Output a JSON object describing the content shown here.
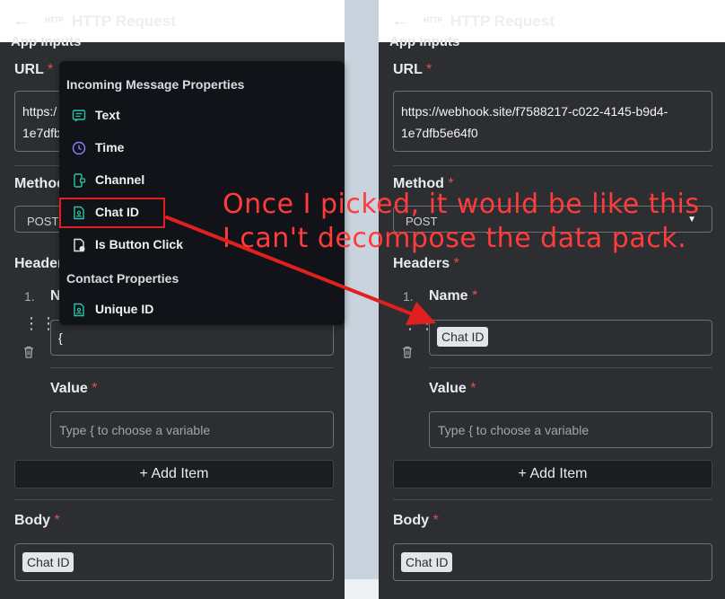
{
  "header": {
    "badge": "HTTP",
    "title": "HTTP Request",
    "back_icon": "arrow-left-icon"
  },
  "section_label": "App Inputs",
  "labels": {
    "url": "URL",
    "method": "Method",
    "headers": "Headers",
    "name": "Name",
    "value": "Value",
    "body": "Body",
    "required_mark": "*"
  },
  "left": {
    "url_line1": "https:/",
    "url_line2": "1e7dfb",
    "method_value": "POST",
    "name_value": "{",
    "value_placeholder": "Type { to choose a variable",
    "add_item": "+ Add Item",
    "body_chip": "Chat ID",
    "list_number": "1."
  },
  "right": {
    "url_line1": "https://webhook.site/f7588217-c022-4145-b9d4-",
    "url_line2": "1e7dfb5e64f0",
    "method_value": "POST",
    "name_chip": "Chat ID",
    "value_placeholder": "Type { to choose a variable",
    "add_item": "+ Add Item",
    "body_chip": "Chat ID",
    "list_number": "1."
  },
  "dropdown": {
    "heading_incoming": "Incoming Message Properties",
    "items_incoming": [
      {
        "label": "Text",
        "icon": "message-icon"
      },
      {
        "label": "Time",
        "icon": "clock-icon"
      },
      {
        "label": "Channel",
        "icon": "phone-chat-icon"
      },
      {
        "label": "Chat ID",
        "icon": "id-document-icon"
      },
      {
        "label": "Is Button Click",
        "icon": "document-check-icon"
      }
    ],
    "heading_contact": "Contact Properties",
    "items_contact": [
      {
        "label": "Unique ID",
        "icon": "id-document-icon"
      }
    ]
  },
  "annotation": {
    "line1": "Once I picked, it would be like this",
    "line2": "I can't decompose the data pack."
  },
  "colors": {
    "panel_bg": "#2c2e32",
    "dropdown_bg": "#111318",
    "accent_teal": "#2ec4a6",
    "accent_purple": "#8f7dff",
    "required": "#e05252",
    "annotation_red": "#ff3b3b"
  }
}
